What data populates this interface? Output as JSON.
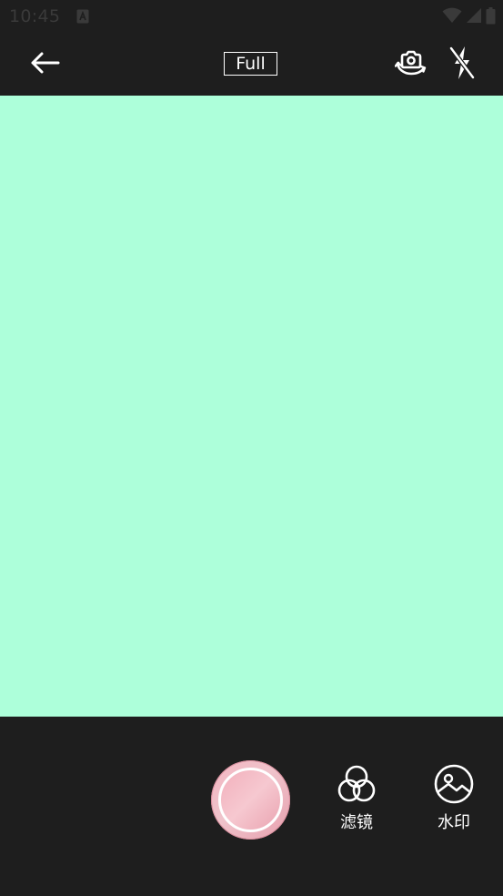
{
  "status_bar": {
    "time": "10:45",
    "icons": [
      "notification-a-icon",
      "wifi-icon",
      "cellular-signal-icon",
      "battery-icon"
    ]
  },
  "toolbar": {
    "back_icon": "arrow-left-icon",
    "ratio_label": "Full",
    "switch_camera_icon": "camera-switch-icon",
    "flash_icon": "flash-off-icon"
  },
  "preview": {
    "background_color": "#adffda"
  },
  "bottom": {
    "shutter_icon": "shutter-icon",
    "filter_label": "滤镜",
    "filter_icon": "filter-circles-icon",
    "watermark_label": "水印",
    "watermark_icon": "image-landscape-icon"
  },
  "colors": {
    "bar_background": "#1e1e1e",
    "preview": "#adffda",
    "shutter_pink": "#f3b6c1",
    "foreground": "#ffffff"
  }
}
